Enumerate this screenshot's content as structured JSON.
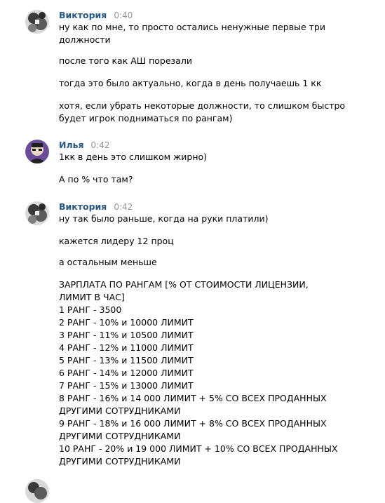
{
  "messages": [
    {
      "author": "Виктория",
      "time": "0:40",
      "avatar": "victoria-avatar",
      "lines": [
        "ну как по мне, то просто остались ненужные первые три",
        "должности",
        "после того как АШ порезали",
        "тогда это было актуально, когда в день получаешь 1 кк",
        "хотя, если убрать некоторые должности, то слишком быстро",
        "будет игрок подниматься по рангам)"
      ]
    },
    {
      "author": "Илья",
      "time": "0:42",
      "avatar": "ilya-avatar",
      "lines": [
        "1кк в день это слишком жирно)",
        "А по % что там?"
      ]
    },
    {
      "author": "Виктория",
      "time": "0:42",
      "avatar": "victoria-avatar",
      "lines": [
        "ну так было раньше, когда на руки платили)",
        "кажется лидеру 12 проц",
        "а остальным меньше",
        "ЗАРПЛАТА ПО РАНГАМ [% ОТ СТОИМОСТИ ЛИЦЕНЗИИ,",
        "ЛИМИТ В ЧАС]",
        "1 РАНГ - 3500",
        "2 РАНГ - 10% и 10000 ЛИМИТ",
        "3 РАНГ - 11% и 10500 ЛИМИТ",
        "4 РАНГ - 12% и 11000 ЛИМИТ",
        "5 РАНГ - 13% и 11500 ЛИМИТ",
        "6 РАНГ - 14% и 12000 ЛИМИТ",
        "7 РАНГ - 15% и 13000 ЛИМИТ",
        "8 РАНГ - 16% и 14 000 ЛИМИТ + 5% СО ВСЕХ ПРОДАННЫХ",
        "ДРУГИМИ СОТРУДНИКАМИ",
        "9 РАНГ - 18% и 16 000 ЛИМИТ + 8% СО ВСЕХ ПРОДАННЫХ",
        "ДРУГИМИ СОТРУДНИКАМИ",
        "10 РАНГ - 20% и 19 000 ЛИМИТ + 10% СО ВСЕХ ПРОДАННЫХ",
        "ДРУГИМИ СОТРУДНИКАМИ"
      ]
    }
  ],
  "colors": {
    "author": "#2a5885",
    "time": "#939393",
    "text": "#000000"
  }
}
